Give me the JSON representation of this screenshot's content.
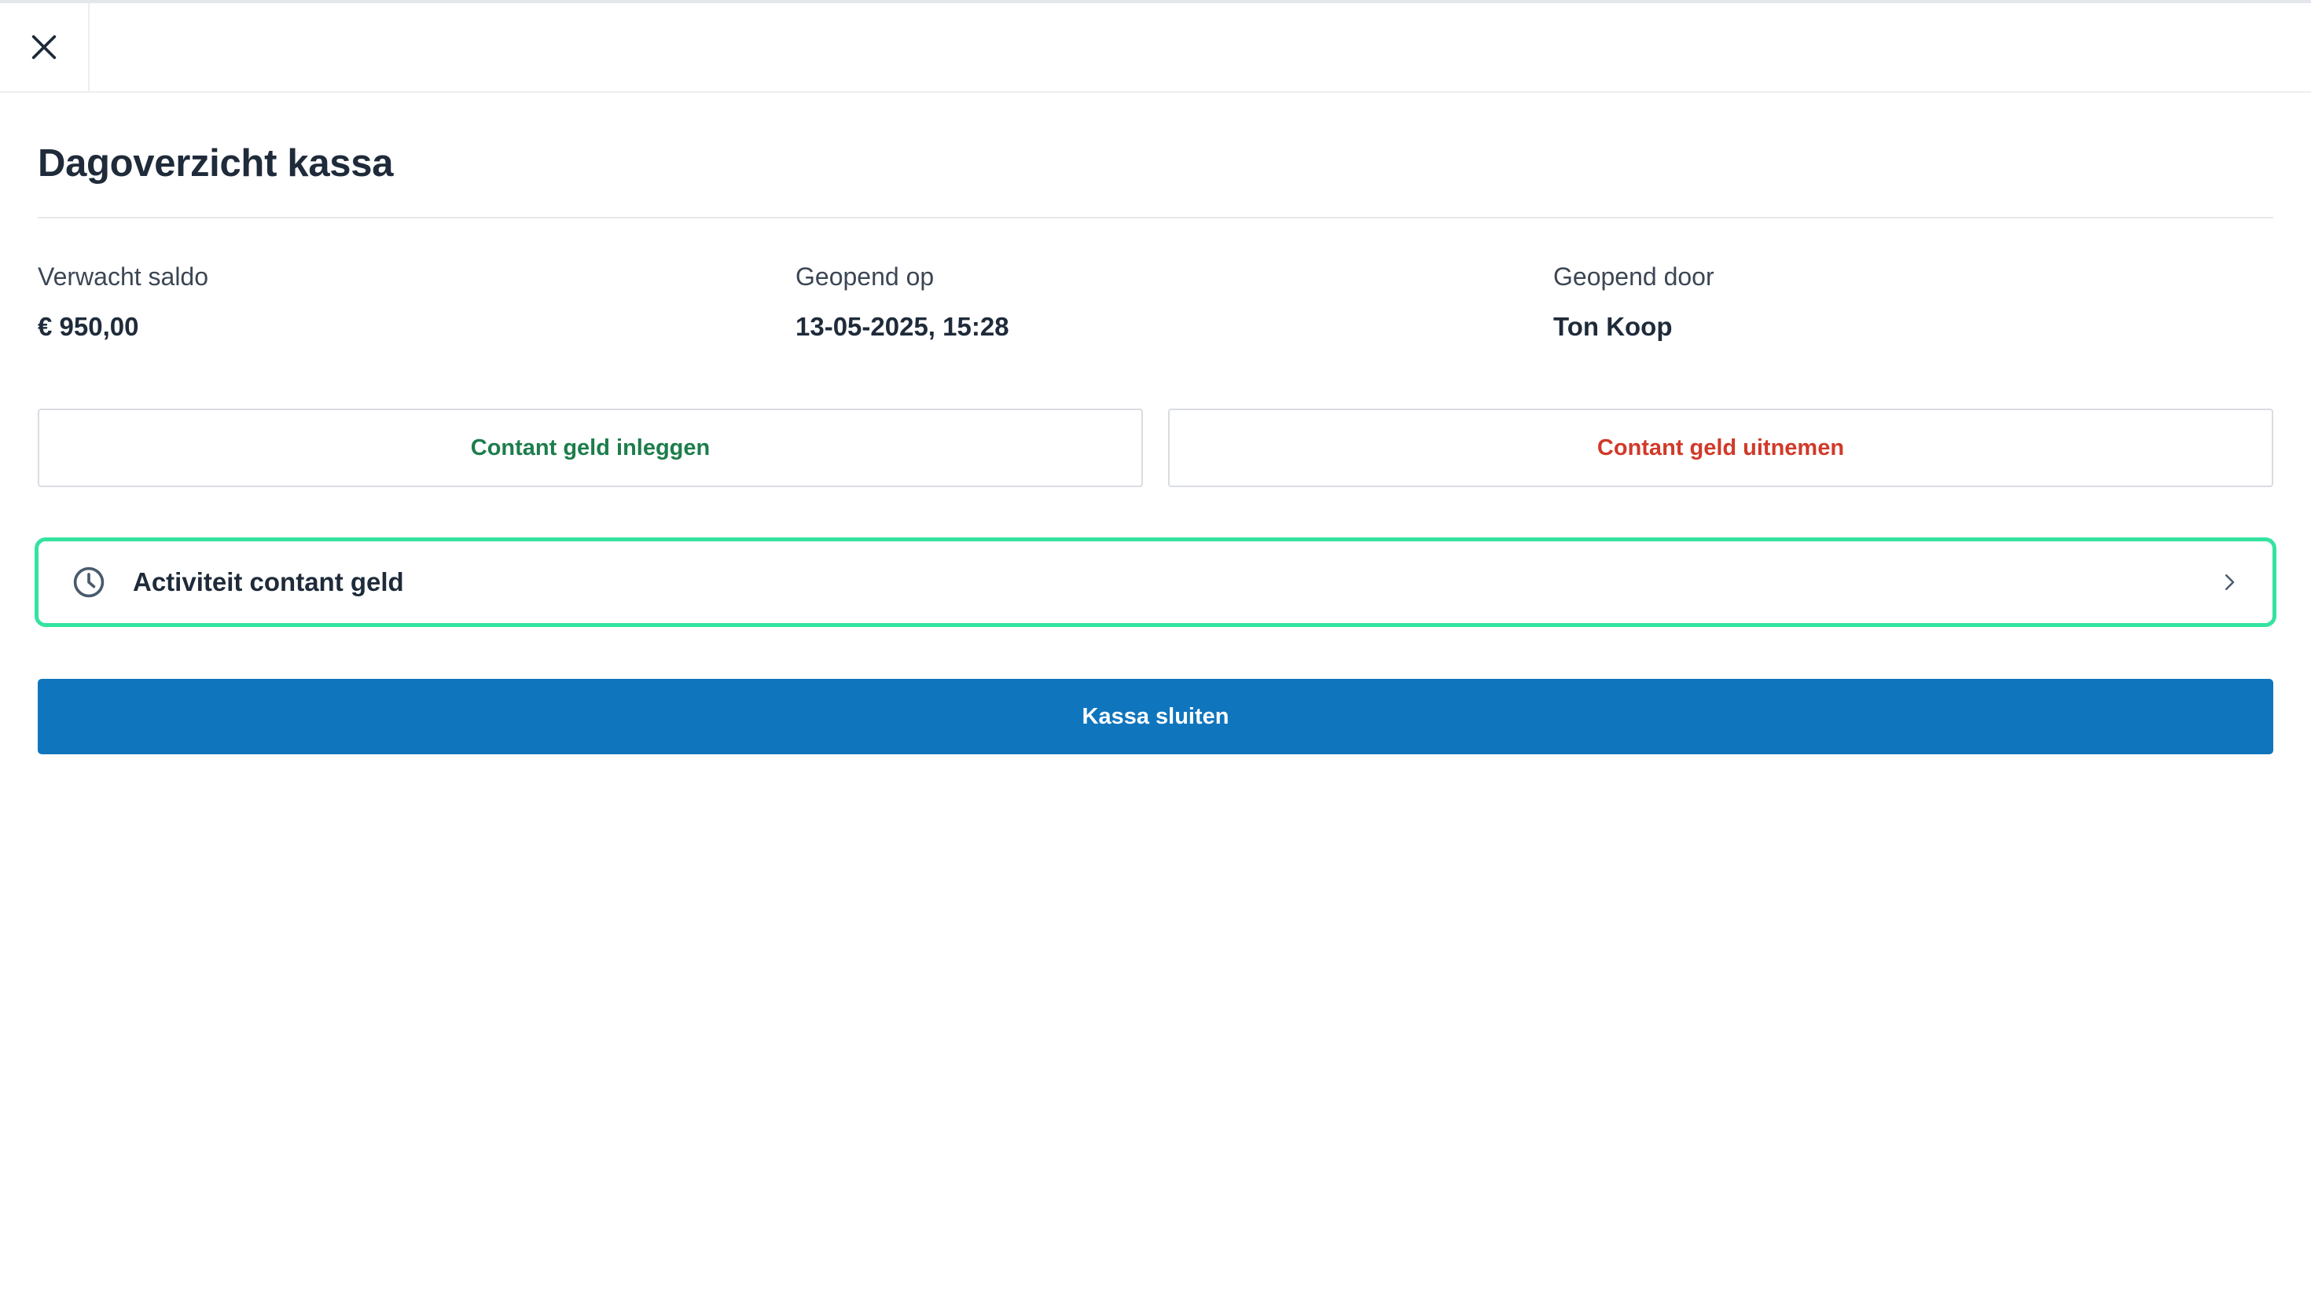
{
  "header": {
    "close_icon": "close-icon"
  },
  "page": {
    "title": "Dagoverzicht kassa"
  },
  "info": {
    "expected_balance_label": "Verwacht saldo",
    "expected_balance_value": "€ 950,00",
    "opened_on_label": "Geopend op",
    "opened_on_value": "13-05-2025, 15:28",
    "opened_by_label": "Geopend door",
    "opened_by_value": "Ton Koop"
  },
  "actions": {
    "cash_in_label": "Contant geld inleggen",
    "cash_out_label": "Contant geld uitnemen",
    "activity_label": "Activiteit contant geld",
    "activity_icon": "clock-icon",
    "activity_chevron_icon": "chevron-right-icon",
    "close_register_label": "Kassa sluiten"
  },
  "colors": {
    "cash_in": "#1d7d4c",
    "cash_out": "#d03a2a",
    "focus_outline": "#34e3a0",
    "primary_button": "#0f75bd"
  }
}
